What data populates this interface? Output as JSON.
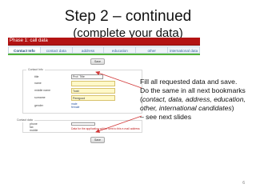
{
  "slide": {
    "title": "Step 2 – continued",
    "subtitle": "(complete your data)",
    "page_number": "6"
  },
  "screenshot": {
    "header_title": "Phase 1: call data",
    "tabs": [
      {
        "label": "Contact Info",
        "active": true
      },
      {
        "label": "contact data",
        "active": false
      },
      {
        "label": "address",
        "active": false
      },
      {
        "label": "education",
        "active": false
      },
      {
        "label": "other",
        "active": false
      },
      {
        "label": "international data",
        "active": false
      }
    ],
    "save_button": "Save",
    "section1": {
      "legend": "Contact Info",
      "fields": [
        {
          "label": "title",
          "value": "Prof. Title"
        },
        {
          "label": "name",
          "value": ""
        },
        {
          "label": "middle name",
          "value": "Todd"
        },
        {
          "label": "surname",
          "value": "Peregood"
        }
      ],
      "gender_label": "gender",
      "gender_options": [
        "male",
        "female"
      ]
    },
    "section2": {
      "legend": "Contact data",
      "fields": [
        {
          "label": "phone",
          "value": ""
        },
        {
          "label": "fax",
          "value": ""
        },
        {
          "label": "mobile",
          "value": ""
        }
      ],
      "note": "Data for the application will be sent to this e-mail address"
    },
    "save_button_bottom": "Save"
  },
  "callout": {
    "line1": "Fill all requested data and save.",
    "line2": "Do the same in all next bookmarks",
    "line3_open": "(",
    "line3_em": "contact, data, address, education,",
    "line4_em": "other, international candidates",
    "line4_close": ")",
    "line5": "– see next slides"
  },
  "colors": {
    "header_red": "#b31313",
    "tab_underline_green": "#52b43c",
    "input_yellow": "#fff9c9",
    "arrow_red": "#d23a3a"
  }
}
